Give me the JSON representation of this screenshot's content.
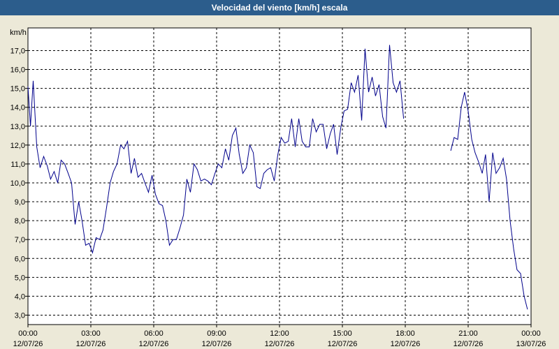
{
  "window": {
    "title": "Velocidad del viento [km/h] escala"
  },
  "chart_data": {
    "type": "line",
    "title": "Velocidad del viento [km/h] escala",
    "ylabel": "km/h",
    "xlabel": "",
    "ylim": [
      2.5,
      18.2
    ],
    "xlim": [
      0,
      24
    ],
    "grid": true,
    "yticks": [
      {
        "v": 3,
        "label": "3,0"
      },
      {
        "v": 4,
        "label": "4,0"
      },
      {
        "v": 5,
        "label": "5,0"
      },
      {
        "v": 6,
        "label": "6,0"
      },
      {
        "v": 7,
        "label": "7,0"
      },
      {
        "v": 8,
        "label": "8,0"
      },
      {
        "v": 9,
        "label": "9,0"
      },
      {
        "v": 10,
        "label": "10,0"
      },
      {
        "v": 11,
        "label": "11,0"
      },
      {
        "v": 12,
        "label": "12,0"
      },
      {
        "v": 13,
        "label": "13,0"
      },
      {
        "v": 14,
        "label": "14,0"
      },
      {
        "v": 15,
        "label": "15,0"
      },
      {
        "v": 16,
        "label": "16,0"
      },
      {
        "v": 17,
        "label": "17,0"
      }
    ],
    "xticks": [
      {
        "v": 0,
        "time": "00:00",
        "date": "12/07/26"
      },
      {
        "v": 3,
        "time": "03:00",
        "date": "12/07/26"
      },
      {
        "v": 6,
        "time": "06:00",
        "date": "12/07/26"
      },
      {
        "v": 9,
        "time": "09:00",
        "date": "12/07/26"
      },
      {
        "v": 12,
        "time": "12:00",
        "date": "12/07/26"
      },
      {
        "v": 15,
        "time": "15:00",
        "date": "12/07/26"
      },
      {
        "v": 18,
        "time": "18:00",
        "date": "12/07/26"
      },
      {
        "v": 21,
        "time": "21:00",
        "date": "12/07/26"
      },
      {
        "v": 24,
        "time": "00:00",
        "date": "13/07/26"
      }
    ],
    "color": "#00008b",
    "series": [
      {
        "segments": [
          [
            [
              0.0,
              15.1
            ],
            [
              0.12,
              13.0
            ],
            [
              0.25,
              15.4
            ],
            [
              0.42,
              11.9
            ],
            [
              0.58,
              10.8
            ],
            [
              0.75,
              11.4
            ],
            [
              0.92,
              10.9
            ],
            [
              1.08,
              10.2
            ],
            [
              1.25,
              10.6
            ],
            [
              1.42,
              10.0
            ],
            [
              1.58,
              11.2
            ],
            [
              1.75,
              11.0
            ],
            [
              1.92,
              10.5
            ],
            [
              2.08,
              10.0
            ],
            [
              2.25,
              7.8
            ],
            [
              2.42,
              9.0
            ],
            [
              2.58,
              8.0
            ],
            [
              2.75,
              6.7
            ],
            [
              2.92,
              6.8
            ],
            [
              3.08,
              6.3
            ],
            [
              3.25,
              7.1
            ],
            [
              3.42,
              7.0
            ],
            [
              3.58,
              7.5
            ],
            [
              3.75,
              8.7
            ],
            [
              3.92,
              10.0
            ],
            [
              4.08,
              10.6
            ],
            [
              4.25,
              11.0
            ],
            [
              4.42,
              12.0
            ],
            [
              4.58,
              11.8
            ],
            [
              4.75,
              12.2
            ],
            [
              4.92,
              10.5
            ],
            [
              5.08,
              11.3
            ],
            [
              5.25,
              10.3
            ],
            [
              5.42,
              10.5
            ],
            [
              5.58,
              10.0
            ],
            [
              5.75,
              9.5
            ],
            [
              5.92,
              10.4
            ],
            [
              6.08,
              9.4
            ],
            [
              6.25,
              8.9
            ],
            [
              6.42,
              8.8
            ],
            [
              6.58,
              8.0
            ],
            [
              6.75,
              6.7
            ],
            [
              6.92,
              7.0
            ],
            [
              7.08,
              7.0
            ],
            [
              7.25,
              7.6
            ],
            [
              7.42,
              8.3
            ],
            [
              7.58,
              10.2
            ],
            [
              7.75,
              9.5
            ],
            [
              7.92,
              11.0
            ],
            [
              8.08,
              10.7
            ],
            [
              8.25,
              10.1
            ],
            [
              8.42,
              10.2
            ],
            [
              8.58,
              10.1
            ],
            [
              8.75,
              9.9
            ],
            [
              8.92,
              10.5
            ],
            [
              9.08,
              11.0
            ],
            [
              9.25,
              10.8
            ],
            [
              9.42,
              11.8
            ],
            [
              9.58,
              11.2
            ],
            [
              9.75,
              12.5
            ],
            [
              9.92,
              12.9
            ],
            [
              10.08,
              11.5
            ],
            [
              10.25,
              10.5
            ],
            [
              10.42,
              10.8
            ],
            [
              10.58,
              12.0
            ],
            [
              10.75,
              11.6
            ],
            [
              10.92,
              9.8
            ],
            [
              11.08,
              9.7
            ],
            [
              11.25,
              10.5
            ],
            [
              11.42,
              10.7
            ],
            [
              11.58,
              10.8
            ],
            [
              11.75,
              10.1
            ],
            [
              11.92,
              11.5
            ],
            [
              12.08,
              12.4
            ],
            [
              12.25,
              12.1
            ],
            [
              12.42,
              12.2
            ],
            [
              12.58,
              13.4
            ],
            [
              12.75,
              11.9
            ],
            [
              12.92,
              13.4
            ],
            [
              13.08,
              12.2
            ],
            [
              13.25,
              11.9
            ],
            [
              13.42,
              11.9
            ],
            [
              13.58,
              13.4
            ],
            [
              13.75,
              12.7
            ],
            [
              13.92,
              13.1
            ],
            [
              14.08,
              13.1
            ],
            [
              14.25,
              11.8
            ],
            [
              14.42,
              12.6
            ],
            [
              14.58,
              13.1
            ],
            [
              14.75,
              11.5
            ],
            [
              14.92,
              12.9
            ],
            [
              15.08,
              13.8
            ],
            [
              15.25,
              13.9
            ],
            [
              15.42,
              15.3
            ],
            [
              15.58,
              14.8
            ],
            [
              15.75,
              15.7
            ],
            [
              15.92,
              13.3
            ],
            [
              16.08,
              17.1
            ],
            [
              16.25,
              14.8
            ],
            [
              16.42,
              15.6
            ],
            [
              16.58,
              14.6
            ],
            [
              16.75,
              15.2
            ],
            [
              16.92,
              13.5
            ],
            [
              17.08,
              12.9
            ],
            [
              17.25,
              17.3
            ],
            [
              17.42,
              15.3
            ],
            [
              17.58,
              14.8
            ],
            [
              17.75,
              15.4
            ],
            [
              17.92,
              13.4
            ]
          ],
          [
            [
              20.17,
              11.7
            ],
            [
              20.33,
              12.4
            ],
            [
              20.5,
              12.3
            ],
            [
              20.67,
              14.0
            ],
            [
              20.83,
              14.8
            ],
            [
              21.0,
              13.8
            ],
            [
              21.17,
              12.3
            ],
            [
              21.33,
              11.6
            ],
            [
              21.5,
              11.1
            ],
            [
              21.67,
              10.5
            ],
            [
              21.83,
              11.5
            ],
            [
              22.0,
              9.0
            ],
            [
              22.17,
              11.6
            ],
            [
              22.33,
              10.5
            ],
            [
              22.5,
              10.8
            ],
            [
              22.67,
              11.3
            ],
            [
              22.83,
              10.2
            ],
            [
              23.0,
              8.0
            ],
            [
              23.17,
              6.5
            ],
            [
              23.33,
              5.4
            ],
            [
              23.5,
              5.2
            ],
            [
              23.67,
              4.0
            ],
            [
              23.83,
              3.3
            ]
          ]
        ]
      }
    ]
  }
}
